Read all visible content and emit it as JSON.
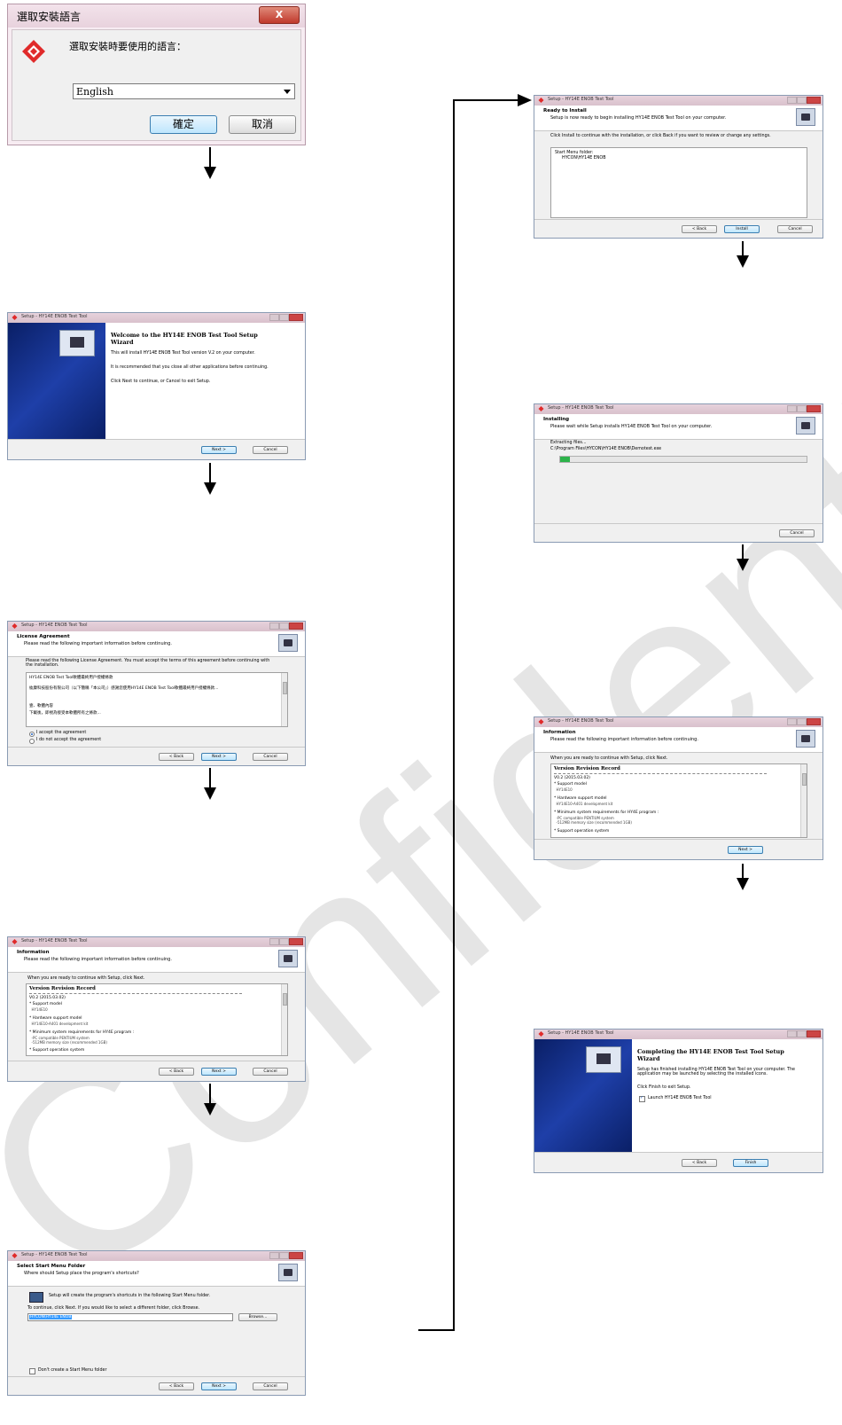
{
  "watermark": "Confidential",
  "lang_dialog": {
    "title": "選取安裝語言",
    "prompt": "選取安裝時要使用的語言：",
    "selected": "English",
    "ok": "確定",
    "cancel": "取消"
  },
  "welcome": {
    "title": "Setup - HY14E ENOB Test Tool",
    "heading": "Welcome to the HY14E ENOB Test Tool Setup Wizard",
    "p1": "This will install HY14E ENOB Test Tool version V.2 on your computer.",
    "p2": "It is recommended that you close all other applications before continuing.",
    "p3": "Click Next to continue, or Cancel to exit Setup.",
    "next": "Next >",
    "cancel": "Cancel"
  },
  "license": {
    "title": "Setup - HY14E ENOB Test Tool",
    "h1": "License Agreement",
    "h2": "Please read the following important information before continuing.",
    "intro": "Please read the following License Agreement. You must accept the terms of this agreement before continuing with the installation.",
    "memo": [
      "HY14E ENOB Test Tool軟體最終用戶授權條款",
      "紘康科技股份有限公司（以下簡稱「本公司」）感謝您使用HY14E ENOB Test Tool軟體最終用戶授權條款...",
      "壹、軟體內容",
      "下載後，即視為接受本軟體所有之條款..."
    ],
    "accept": "I accept the agreement",
    "decline": "I do not accept the agreement",
    "back": "< Back",
    "next": "Next >",
    "cancel": "Cancel"
  },
  "info_left": {
    "title": "Setup - HY14E ENOB Test Tool",
    "h1": "Information",
    "h2": "Please read the following important information before continuing.",
    "intro": "When you are ready to continue with Setup, click Next.",
    "memo_title": "Version Revision Record",
    "memo": [
      "V0.2 (2015.03.02)",
      "* Support model",
      "  HY14E10",
      "* Hardware support model",
      "  HY14E10-A401 development kit",
      "* Minimum system requirements for HY4E program :",
      "  -PC compatible PENTIUM system",
      "  -512MB memory size (recommended 1GB)",
      "* Support operation system"
    ],
    "back": "< Back",
    "next": "Next >",
    "cancel": "Cancel"
  },
  "startmenu": {
    "title": "Setup - HY14E ENOB Test Tool",
    "h1": "Select Start Menu Folder",
    "h2": "Where should Setup place the program's shortcuts?",
    "line1": "Setup will create the program's shortcuts in the following Start Menu folder.",
    "line2": "To continue, click Next. If you would like to select a different folder, click Browse.",
    "folder": "HYCON\\HY14E ENOB",
    "browse": "Browse...",
    "nofolder": "Don't create a Start Menu folder",
    "back": "< Back",
    "next": "Next >",
    "cancel": "Cancel"
  },
  "ready": {
    "title": "Setup - HY14E ENOB Test Tool",
    "h1": "Ready to Install",
    "h2": "Setup is now ready to begin installing HY14E ENOB Test Tool on your computer.",
    "intro": "Click Install to continue with the installation, or click Back if you want to review or change any settings.",
    "memo1": "Start Menu folder:",
    "memo2": "HYCON\\HY14E ENOB",
    "back": "< Back",
    "install": "Install",
    "cancel": "Cancel"
  },
  "installing": {
    "title": "Setup - HY14E ENOB Test Tool",
    "h1": "Installing",
    "h2": "Please wait while Setup installs HY14E ENOB Test Tool on your computer.",
    "status": "Extracting files...",
    "path": "C:\\Program Files\\HYCON\\HY14E ENOB\\Demotest.exe",
    "progress": 0.04,
    "cancel": "Cancel"
  },
  "info_right": {
    "title": "Setup - HY14E ENOB Test Tool",
    "h1": "Information",
    "h2": "Please read the following important information before continuing.",
    "intro": "When you are ready to continue with Setup, click Next.",
    "memo_title": "Version Revision Record",
    "memo": [
      "V0.2 (2015.03.02)",
      "* Support model",
      "  HY14E10",
      "* Hardware support model",
      "  HY14E10-A401 development kit",
      "* Minimum system requirements for HY4E program :",
      "  -PC compatible PENTIUM system",
      "  -512MB memory size (recommended 1GB)",
      "* Support operation system"
    ],
    "next": "Next >"
  },
  "finish": {
    "title": "Setup - HY14E ENOB Test Tool",
    "heading": "Completing the HY14E ENOB Test Tool Setup Wizard",
    "p1": "Setup has finished installing HY14E ENOB Test Tool on your computer. The application may be launched by selecting the installed icons.",
    "p2": "Click Finish to exit Setup.",
    "launch": "Launch HY14E ENOB Test Tool",
    "back": "< Back",
    "finish": "Finish"
  }
}
